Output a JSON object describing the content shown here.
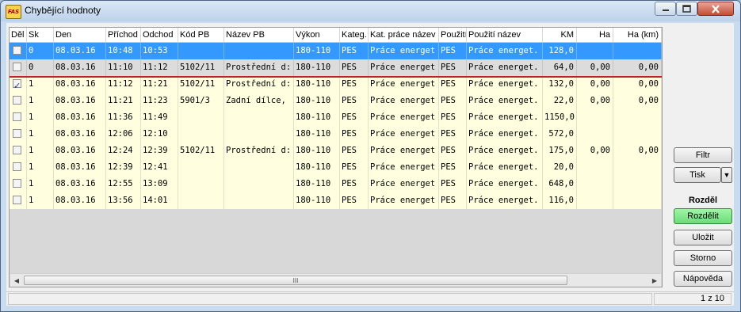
{
  "window": {
    "title": "Chybějící hodnoty",
    "app_icon_text": "FAS",
    "controls": {
      "minimize_icon": "minimize-icon",
      "maximize_icon": "maximize-icon",
      "close_icon": "close-icon"
    }
  },
  "grid": {
    "columns": [
      "Děl",
      "Sk",
      "Den",
      "Příchod",
      "Odchod",
      "Kód PB",
      "Název PB",
      "Výkon",
      "Kateg.",
      "Kat. práce název",
      "Použití",
      "Použití název",
      "KM",
      "Ha",
      "Ha (km)"
    ],
    "rows": [
      {
        "checked": false,
        "sk": "0",
        "den": "08.03.16",
        "prichod": "10:48",
        "odchod": "10:53",
        "kod_pb": "",
        "nazev_pb": "",
        "vykon": "180-110",
        "kateg": "PES",
        "kat_prace": "Práce energet",
        "pouziti": "PES",
        "pouziti_nazev": "Práce energet.",
        "km": "128,0",
        "ha": "",
        "ha_km": ""
      },
      {
        "checked": false,
        "sk": "0",
        "den": "08.03.16",
        "prichod": "11:10",
        "odchod": "11:12",
        "kod_pb": "5102/11",
        "nazev_pb": "Prostřední d:",
        "vykon": "180-110",
        "kateg": "PES",
        "kat_prace": "Práce energet",
        "pouziti": "PES",
        "pouziti_nazev": "Práce energet.",
        "km": "64,0",
        "ha": "0,00",
        "ha_km": "0,00"
      },
      {
        "checked": true,
        "sk": "1",
        "den": "08.03.16",
        "prichod": "11:12",
        "odchod": "11:21",
        "kod_pb": "5102/11",
        "nazev_pb": "Prostřední d:",
        "vykon": "180-110",
        "kateg": "PES",
        "kat_prace": "Práce energet",
        "pouziti": "PES",
        "pouziti_nazev": "Práce energet.",
        "km": "132,0",
        "ha": "0,00",
        "ha_km": "0,00"
      },
      {
        "checked": false,
        "sk": "1",
        "den": "08.03.16",
        "prichod": "11:21",
        "odchod": "11:23",
        "kod_pb": "5901/3",
        "nazev_pb": "Zadní dílce,",
        "vykon": "180-110",
        "kateg": "PES",
        "kat_prace": "Práce energet",
        "pouziti": "PES",
        "pouziti_nazev": "Práce energet.",
        "km": "22,0",
        "ha": "0,00",
        "ha_km": "0,00"
      },
      {
        "checked": false,
        "sk": "1",
        "den": "08.03.16",
        "prichod": "11:36",
        "odchod": "11:49",
        "kod_pb": "",
        "nazev_pb": "",
        "vykon": "180-110",
        "kateg": "PES",
        "kat_prace": "Práce energet",
        "pouziti": "PES",
        "pouziti_nazev": "Práce energet.",
        "km": "1150,0",
        "ha": "",
        "ha_km": ""
      },
      {
        "checked": false,
        "sk": "1",
        "den": "08.03.16",
        "prichod": "12:06",
        "odchod": "12:10",
        "kod_pb": "",
        "nazev_pb": "",
        "vykon": "180-110",
        "kateg": "PES",
        "kat_prace": "Práce energet",
        "pouziti": "PES",
        "pouziti_nazev": "Práce energet.",
        "km": "572,0",
        "ha": "",
        "ha_km": ""
      },
      {
        "checked": false,
        "sk": "1",
        "den": "08.03.16",
        "prichod": "12:24",
        "odchod": "12:39",
        "kod_pb": "5102/11",
        "nazev_pb": "Prostřední d:",
        "vykon": "180-110",
        "kateg": "PES",
        "kat_prace": "Práce energet",
        "pouziti": "PES",
        "pouziti_nazev": "Práce energet.",
        "km": "175,0",
        "ha": "0,00",
        "ha_km": "0,00"
      },
      {
        "checked": false,
        "sk": "1",
        "den": "08.03.16",
        "prichod": "12:39",
        "odchod": "12:41",
        "kod_pb": "",
        "nazev_pb": "",
        "vykon": "180-110",
        "kateg": "PES",
        "kat_prace": "Práce energet",
        "pouziti": "PES",
        "pouziti_nazev": "Práce energet.",
        "km": "20,0",
        "ha": "",
        "ha_km": ""
      },
      {
        "checked": false,
        "sk": "1",
        "den": "08.03.16",
        "prichod": "12:55",
        "odchod": "13:09",
        "kod_pb": "",
        "nazev_pb": "",
        "vykon": "180-110",
        "kateg": "PES",
        "kat_prace": "Práce energet",
        "pouziti": "PES",
        "pouziti_nazev": "Práce energet.",
        "km": "648,0",
        "ha": "",
        "ha_km": ""
      },
      {
        "checked": false,
        "sk": "1",
        "den": "08.03.16",
        "prichod": "13:56",
        "odchod": "14:01",
        "kod_pb": "",
        "nazev_pb": "",
        "vykon": "180-110",
        "kateg": "PES",
        "kat_prace": "Práce energet",
        "pouziti": "PES",
        "pouziti_nazev": "Práce energet.",
        "km": "116,0",
        "ha": "",
        "ha_km": ""
      }
    ],
    "scrollbar_grip": "III"
  },
  "side": {
    "filtr_label": "Filtr",
    "tisk_label": "Tisk",
    "tisk_arrow": "▼",
    "group_label": "Rozděl",
    "rozdelit_label": "Rozdělit",
    "ulozit_label": "Uložit",
    "storno_label": "Storno",
    "napoveda_label": "Nápověda"
  },
  "status": {
    "page_info": "1 z 10"
  }
}
